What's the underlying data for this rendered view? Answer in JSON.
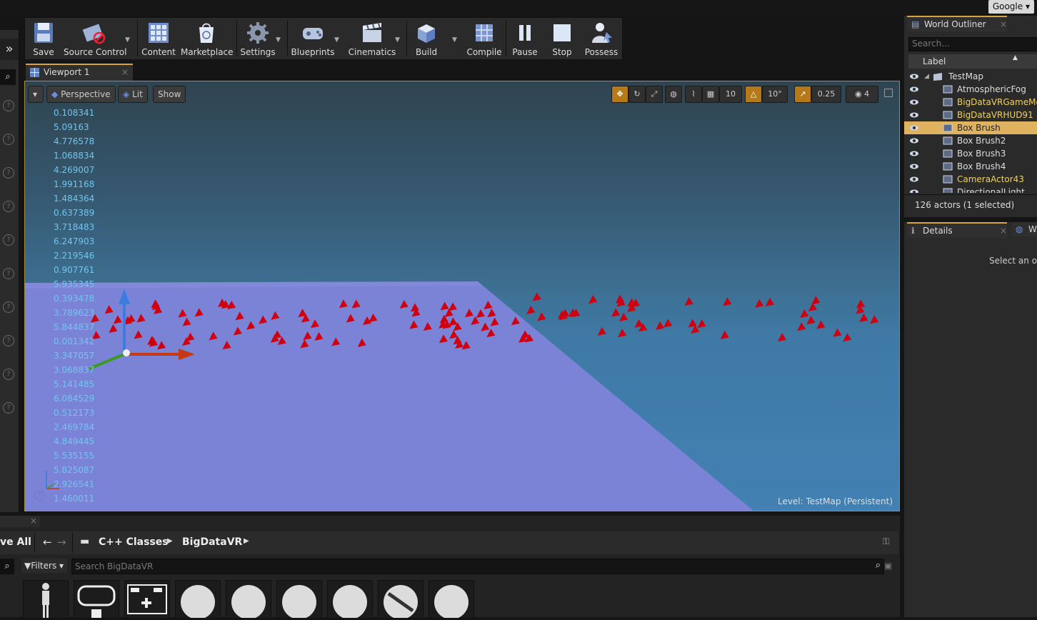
{
  "browser": {
    "google_label": "Google"
  },
  "toolbar": {
    "save": "Save",
    "source_control": "Source Control",
    "content": "Content",
    "marketplace": "Marketplace",
    "settings": "Settings",
    "blueprints": "Blueprints",
    "cinematics": "Cinematics",
    "build": "Build",
    "compile": "Compile",
    "pause": "Pause",
    "stop": "Stop",
    "possess": "Possess"
  },
  "viewport": {
    "tab_label": "Viewport 1",
    "perspective": "Perspective",
    "lit": "Lit",
    "show": "Show",
    "grid_snap": "10",
    "rotation_snap": "10°",
    "scale_snap": "0.25",
    "camera_speed": "4",
    "level_label": "Level:  TestMap (Persistent)",
    "stats": [
      "0.108341",
      "5.09163",
      "4.776578",
      "1.068834",
      "4.269007",
      "1.991168",
      "1.484364",
      "0.637389",
      "3.718483",
      "6.247903",
      "2.219546",
      "0.907761",
      "5.935345",
      "0.393478",
      "3.789623",
      "5.844837",
      "0.001342",
      "3.347057",
      "3.068837",
      "5.141485",
      "6.084529",
      "0.512173",
      "2.469784",
      "4.849445",
      "5.535155",
      "5.825087",
      "2.926541",
      "1.460011"
    ]
  },
  "outliner": {
    "title": "World Outliner",
    "search_placeholder": "Search...",
    "column_label": "Label",
    "items": [
      {
        "label": "TestMap",
        "color": "#dddddd"
      },
      {
        "label": "AtmosphericFog",
        "color": "#dddddd"
      },
      {
        "label": "BigDataVRGameMode",
        "color": "#f0d060"
      },
      {
        "label": "BigDataVRHUD91",
        "color": "#f0d060"
      },
      {
        "label": "Box Brush",
        "color": "#222222"
      },
      {
        "label": "Box Brush2",
        "color": "#dddddd"
      },
      {
        "label": "Box Brush3",
        "color": "#dddddd"
      },
      {
        "label": "Box Brush4",
        "color": "#dddddd"
      },
      {
        "label": "CameraActor43",
        "color": "#f0d060"
      },
      {
        "label": "DirectionalLight",
        "color": "#dddddd"
      }
    ],
    "actor_count": "126 actors (1 selected)"
  },
  "details": {
    "title": "Details",
    "placeholder": "Select an obj"
  },
  "content_browser": {
    "save_all": "ve All",
    "breadcrumb_root": "C++ Classes",
    "breadcrumb_child": "BigDataVR",
    "filters": "Filters",
    "search_placeholder": "Search BigDataVR"
  },
  "colors": {
    "accent": "#d8a441",
    "selection": "#dfb25f",
    "stat_text": "#6fc6ee",
    "marker": "#d00010"
  }
}
